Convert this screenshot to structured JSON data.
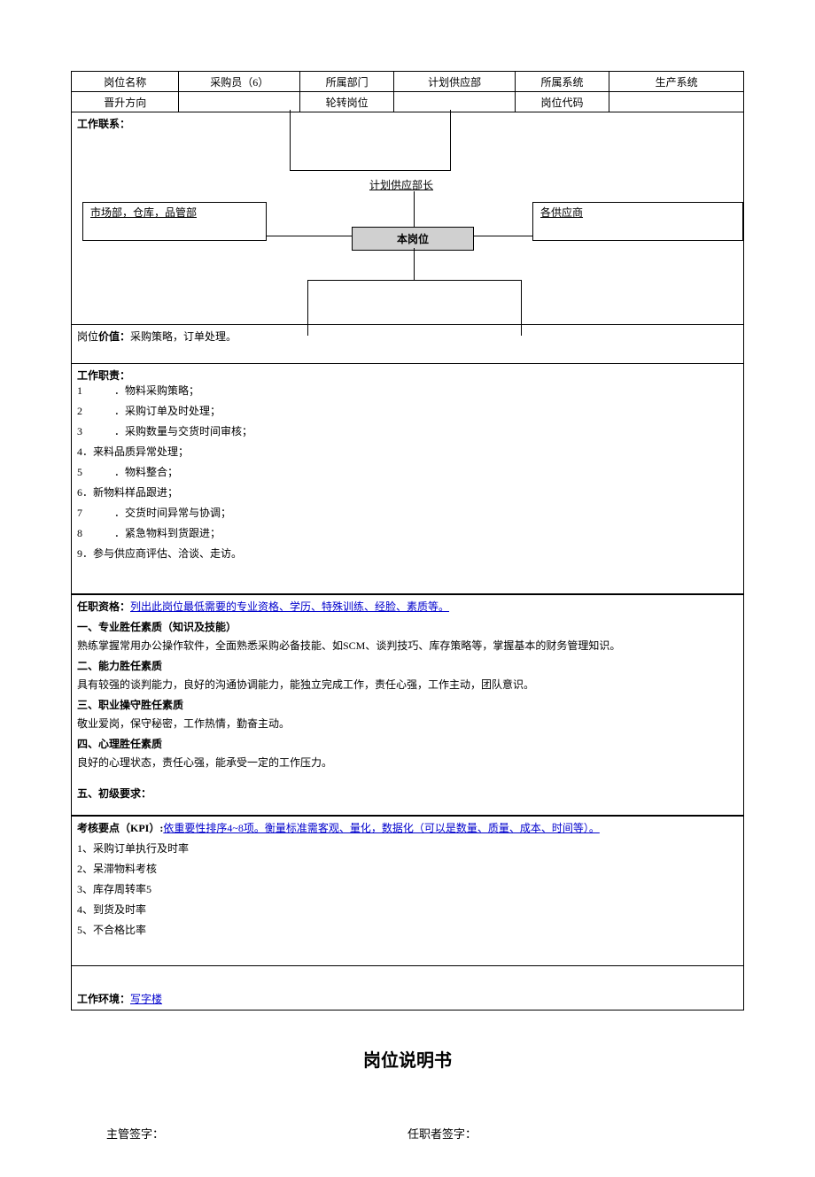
{
  "header": {
    "positionNameLabel": "岗位名称",
    "positionName": "采购员（6）",
    "departmentLabel": "所属部门",
    "department": "计划供应部",
    "systemLabel": "所属系统",
    "system": "生产系统",
    "promotionLabel": "晋升方向",
    "promotion": "",
    "rotationLabel": "轮转岗位",
    "rotation": "",
    "codeLabel": "岗位代码",
    "code": ""
  },
  "workContact": {
    "label": "工作联系：",
    "top": "计划供应部长",
    "left": "市场部，仓库，品管部",
    "center": "本岗位",
    "right": "各供应商"
  },
  "positionValue": {
    "label": "岗位",
    "labelBold": "价值：",
    "text": "采购策略，订单处理。"
  },
  "duties": {
    "label": "工作职责：",
    "items": [
      "1　　　．物料采购策略；",
      "2　　　．采购订单及时处理；",
      "3　　　．采购数量与交货时间审核；",
      "4．来料品质异常处理；",
      "5　　　．物料整合；",
      "6．新物料样品跟进；",
      "7　　　．交货时间异常与协调；",
      "8　　　．紧急物料到货跟进；",
      "9．参与供应商评估、洽谈、走访。"
    ]
  },
  "qualifications": {
    "label": "任职资格：",
    "hint": "列出此岗位最低需要的专业资格、学历、特殊训练、经脸、素质等。",
    "sections": [
      {
        "title": "一、专业胜任素质（知识及技能）",
        "body": "熟练掌握常用办公操作软件，全面熟悉采购必备技能、如SCM、谈判技巧、库存策略等，掌握基本的财务管理知识。"
      },
      {
        "title": "二、能力胜任素质",
        "body": "具有较强的谈判能力，良好的沟通协调能力，能独立完成工作，责任心强，工作主动，团队意识。"
      },
      {
        "title": "三、职业操守胜任素质",
        "body": "敬业爱岗，保守秘密，工作热情，勤奋主动。"
      },
      {
        "title": "四、心理胜任素质",
        "body": "良好的心理状态，责任心强，能承受一定的工作压力。"
      },
      {
        "title": "五、初级要求：",
        "body": ""
      }
    ]
  },
  "kpi": {
    "label": "考核要点（KPI）:",
    "hint": "依重要性排序4~8项。衡量标准需客观、量化，数据化（可以是数量、质量、成本、时间等）。",
    "items": [
      "1、采购订单执行及时率",
      "2、呆滞物料考核",
      "3、库存周转率5",
      "4、到货及时率",
      "5、不合格比率"
    ]
  },
  "environment": {
    "label": "工作环境：",
    "value": "写字楼"
  },
  "docTitle": "岗位说明书",
  "signatures": {
    "supervisor": "主管签字：",
    "holder": "任职者签字："
  }
}
